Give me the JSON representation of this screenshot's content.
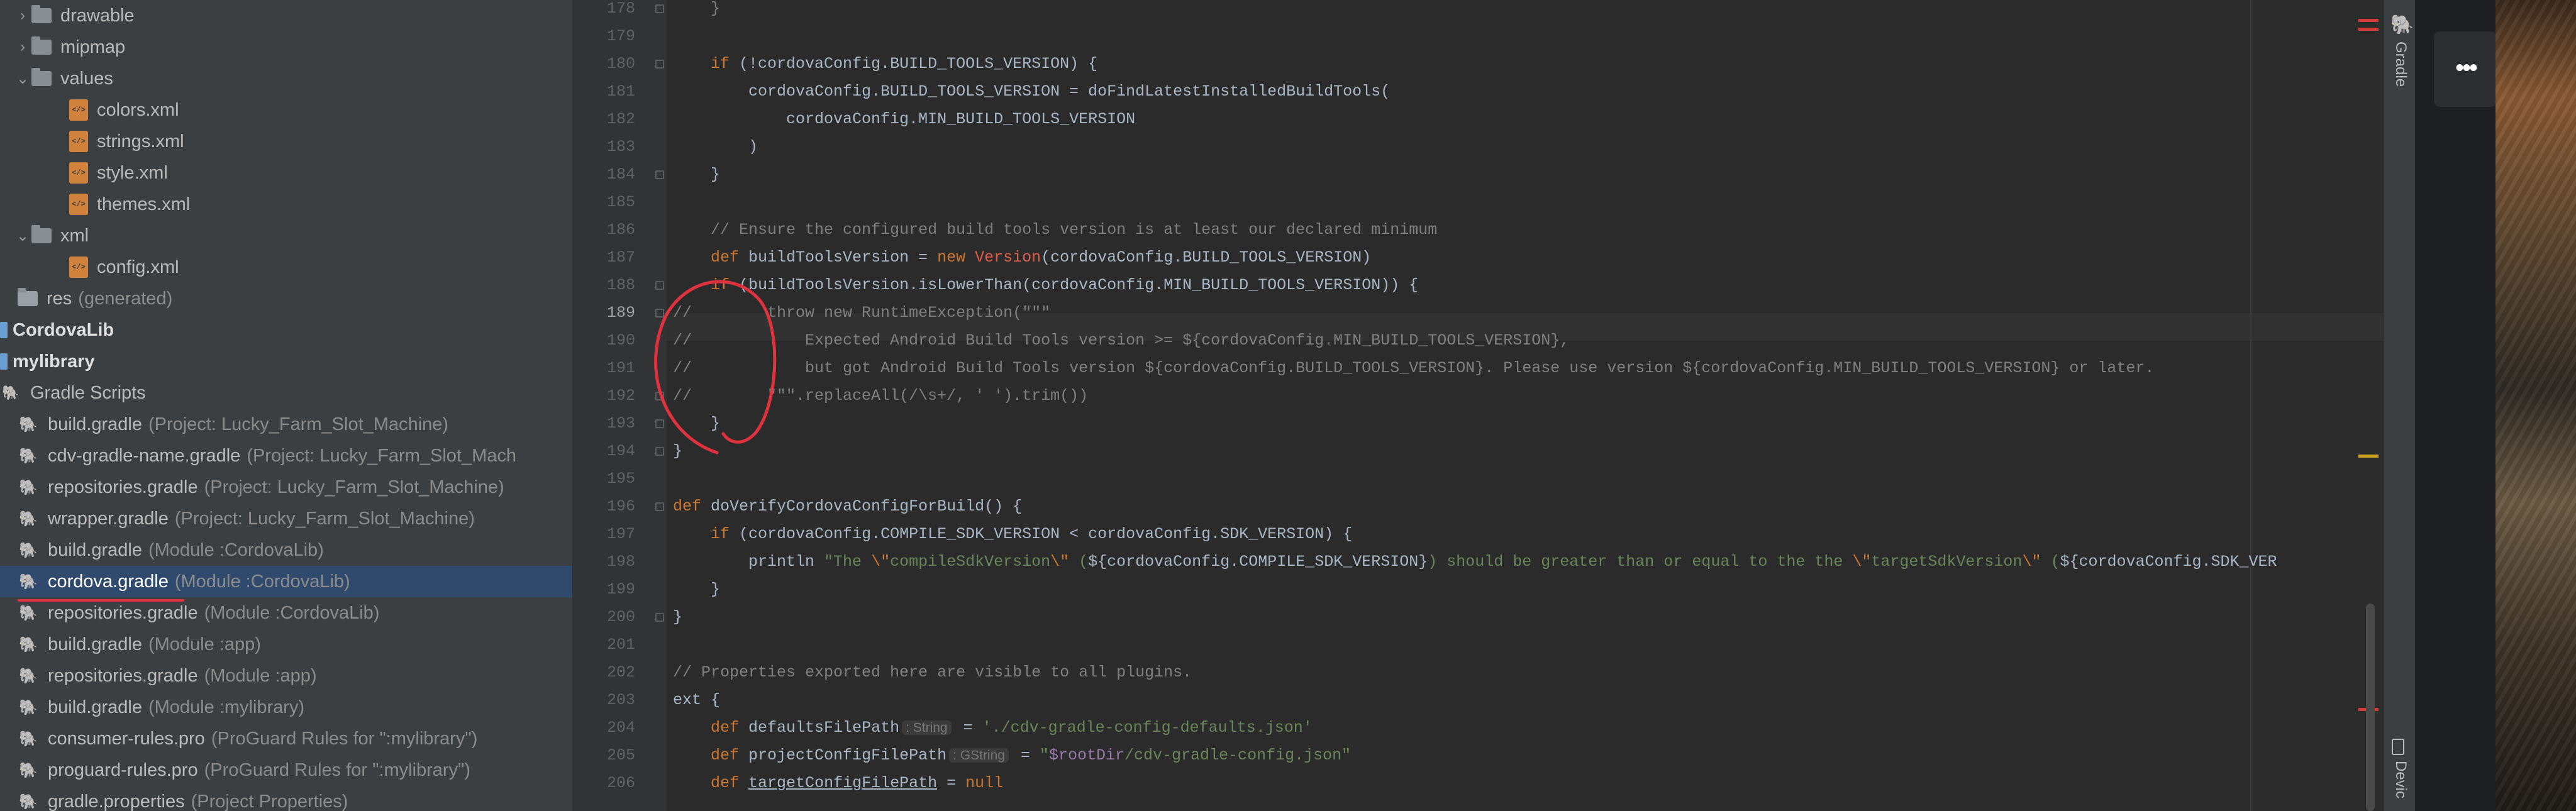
{
  "project_tree": {
    "items": [
      {
        "name": "drawable",
        "desc": "",
        "kind": "folder",
        "arrow": "›"
      },
      {
        "name": "mipmap",
        "desc": "",
        "kind": "folder",
        "arrow": "›"
      },
      {
        "name": "values",
        "desc": "",
        "kind": "folder",
        "arrow": "⌄"
      },
      {
        "name": "colors.xml",
        "desc": "",
        "kind": "xml",
        "arrow": ""
      },
      {
        "name": "strings.xml",
        "desc": "",
        "kind": "xml",
        "arrow": ""
      },
      {
        "name": "style.xml",
        "desc": "",
        "kind": "xml",
        "arrow": ""
      },
      {
        "name": "themes.xml",
        "desc": "",
        "kind": "xml",
        "arrow": ""
      },
      {
        "name": "xml",
        "desc": "",
        "kind": "folder",
        "arrow": "⌄"
      },
      {
        "name": "config.xml",
        "desc": "",
        "kind": "xml",
        "arrow": ""
      },
      {
        "name": "res",
        "desc": "(generated)",
        "kind": "folder-res",
        "arrow": ""
      },
      {
        "name": "CordovaLib",
        "desc": "",
        "kind": "module",
        "arrow": ""
      },
      {
        "name": "mylibrary",
        "desc": "",
        "kind": "module",
        "arrow": ""
      },
      {
        "name": "Gradle Scripts",
        "desc": "",
        "kind": "gradle-root",
        "arrow": ""
      },
      {
        "name": "build.gradle",
        "desc": "(Project: Lucky_Farm_Slot_Machine)",
        "kind": "gradle",
        "arrow": ""
      },
      {
        "name": "cdv-gradle-name.gradle",
        "desc": "(Project: Lucky_Farm_Slot_Mach",
        "kind": "gradle",
        "arrow": ""
      },
      {
        "name": "repositories.gradle",
        "desc": "(Project: Lucky_Farm_Slot_Machine)",
        "kind": "gradle",
        "arrow": ""
      },
      {
        "name": "wrapper.gradle",
        "desc": "(Project: Lucky_Farm_Slot_Machine)",
        "kind": "gradle",
        "arrow": ""
      },
      {
        "name": "build.gradle",
        "desc": "(Module :CordovaLib)",
        "kind": "gradle",
        "arrow": ""
      },
      {
        "name": "cordova.gradle",
        "desc": "(Module :CordovaLib)",
        "kind": "gradle",
        "arrow": "",
        "selected": true
      },
      {
        "name": "repositories.gradle",
        "desc": "(Module :CordovaLib)",
        "kind": "gradle",
        "arrow": ""
      },
      {
        "name": "build.gradle",
        "desc": "(Module :app)",
        "kind": "gradle",
        "arrow": ""
      },
      {
        "name": "repositories.gradle",
        "desc": "(Module :app)",
        "kind": "gradle",
        "arrow": ""
      },
      {
        "name": "build.gradle",
        "desc": "(Module :mylibrary)",
        "kind": "gradle",
        "arrow": ""
      },
      {
        "name": "consumer-rules.pro",
        "desc": "(ProGuard Rules for \":mylibrary\")",
        "kind": "gradle",
        "arrow": ""
      },
      {
        "name": "proguard-rules.pro",
        "desc": "(ProGuard Rules for \":mylibrary\")",
        "kind": "gradle",
        "arrow": ""
      },
      {
        "name": "gradle.properties",
        "desc": "(Project Properties)",
        "kind": "gradle",
        "arrow": ""
      }
    ]
  },
  "editor": {
    "current_line": "189",
    "lines": [
      {
        "n": "178",
        "html": "    <span class='cm'>}</span>"
      },
      {
        "n": "179",
        "html": ""
      },
      {
        "n": "180",
        "html": "    <span class='kw'>if</span> (!cordovaConfig.BUILD_TOOLS_VERSION) {"
      },
      {
        "n": "181",
        "html": "        cordovaConfig.BUILD_TOOLS_VERSION = doFindLatestInstalledBuildTools("
      },
      {
        "n": "182",
        "html": "            cordovaConfig.MIN_BUILD_TOOLS_VERSION"
      },
      {
        "n": "183",
        "html": "        )"
      },
      {
        "n": "184",
        "html": "    }"
      },
      {
        "n": "185",
        "html": ""
      },
      {
        "n": "186",
        "html": "    <span class='cm'>// Ensure the configured build tools version is at least our declared minimum</span>"
      },
      {
        "n": "187",
        "html": "    <span class='kw'>def</span> buildToolsVersion = <span class='kw'>new</span> <span class='red'>Version</span>(cordovaConfig.BUILD_TOOLS_VERSION)"
      },
      {
        "n": "188",
        "html": "    <span class='kw'>if</span> (buildToolsVersion.isLowerThan(cordovaConfig.MIN_BUILD_TOOLS_VERSION)) {"
      },
      {
        "n": "189",
        "html": "<span class='cm'>//        throw new RuntimeException(\"\"\"</span>"
      },
      {
        "n": "190",
        "html": "<span class='cm'>//            Expected Android Build Tools version &gt;= ${cordovaConfig.MIN_BUILD_TOOLS_VERSION},</span>"
      },
      {
        "n": "191",
        "html": "<span class='cm'>//            but got Android Build Tools version ${cordovaConfig.BUILD_TOOLS_VERSION}. Please use version ${cordovaConfig.MIN_BUILD_TOOLS_VERSION} or later.</span>"
      },
      {
        "n": "192",
        "html": "<span class='cm'>//        \"\"\".replaceAll(/\\s+/, ' ').trim())</span>"
      },
      {
        "n": "193",
        "html": "    }"
      },
      {
        "n": "194",
        "html": "}"
      },
      {
        "n": "195",
        "html": ""
      },
      {
        "n": "196",
        "html": "<span class='kw'>def</span> doVerifyCordovaConfigForBuild() {"
      },
      {
        "n": "197",
        "html": "    <span class='kw'>if</span> (cordovaConfig.COMPILE_SDK_VERSION &lt; cordovaConfig.SDK_VERSION) {"
      },
      {
        "n": "198",
        "html": "        println <span class='str'>\"The </span><span class='esc'>\\\"</span><span class='str'>compileSdkVersion</span><span class='esc'>\\\"</span><span class='str'> (</span>${cordovaConfig.COMPILE_SDK_VERSION}<span class='str'>) should be greater than or equal to the the </span><span class='esc'>\\\"</span><span class='str'>targetSdkVersion</span><span class='esc'>\\\"</span><span class='str'> (</span>${cordovaConfig.SDK_VER"
      },
      {
        "n": "199",
        "html": "    }"
      },
      {
        "n": "200",
        "html": "}"
      },
      {
        "n": "201",
        "html": ""
      },
      {
        "n": "202",
        "html": "<span class='cm'>// Properties exported here are visible to all plugins.</span>"
      },
      {
        "n": "203",
        "html": "ext {"
      },
      {
        "n": "204",
        "html": "    <span class='kw'>def</span> defaultsFilePath<span class='hint'>: String</span> = <span class='str'>'./cdv-gradle-config-defaults.json'</span>"
      },
      {
        "n": "205",
        "html": "    <span class='kw'>def</span> projectConfigFilePath<span class='hint'>: GString</span> = <span class='str'>\"</span><span class='purple'>$rootDir</span><span class='str'>/cdv-gradle-config.json\"</span>"
      },
      {
        "n": "206",
        "html": "    <span class='kw'>def</span> <span class='und'>targetConfigFilePath</span> = <span class='kw'>null</span>"
      }
    ]
  },
  "side_panel": {
    "gradle_label": "Gradle",
    "device_label": "Devic"
  },
  "colors": {
    "tree_bg": "#3c3f41",
    "editor_bg": "#2b2b2b",
    "selection": "#2f4a6d",
    "keyword": "#cc7832",
    "comment": "#808080",
    "string": "#6a8759",
    "annotation_red": "#e0323e"
  }
}
